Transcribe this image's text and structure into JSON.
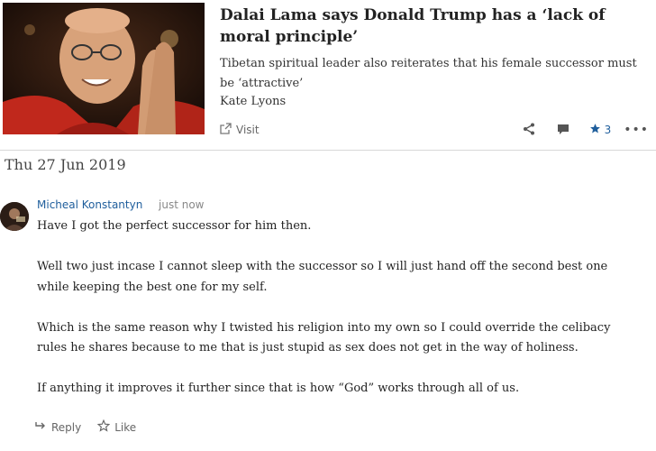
{
  "article": {
    "title": "Dalai Lama says Donald Trump has a ‘lack of moral principle’",
    "description": "Tibetan spiritual leader also reiterates that his female successor must be ‘attractive’",
    "author": "Kate Lyons",
    "visit_label": "Visit",
    "star_count": "3"
  },
  "date": "Thu 27 Jun 2019",
  "comment": {
    "author": "Micheal Konstantyn",
    "time": "just now",
    "paragraphs": [
      "Have I got the perfect successor for him then.",
      "Well two just incase I cannot sleep with the successor so I will just hand off the second best one while keeping the best one for my self.",
      "Which is the same reason why I twisted his religion into my own so I could override the celibacy rules he shares because to me that is just stupid as sex does not get in the way of holiness.",
      "If anything it improves it further since that is how “God” works through all of us."
    ],
    "reply_label": "Reply",
    "like_label": "Like"
  },
  "icons": [
    "external-link-icon",
    "share-icon",
    "comment-icon",
    "star-icon",
    "more-icon",
    "reply-icon",
    "star-outline-icon"
  ],
  "colors": {
    "link": "#1f5e9c",
    "muted": "#666666",
    "divider": "#d8d8d8"
  }
}
